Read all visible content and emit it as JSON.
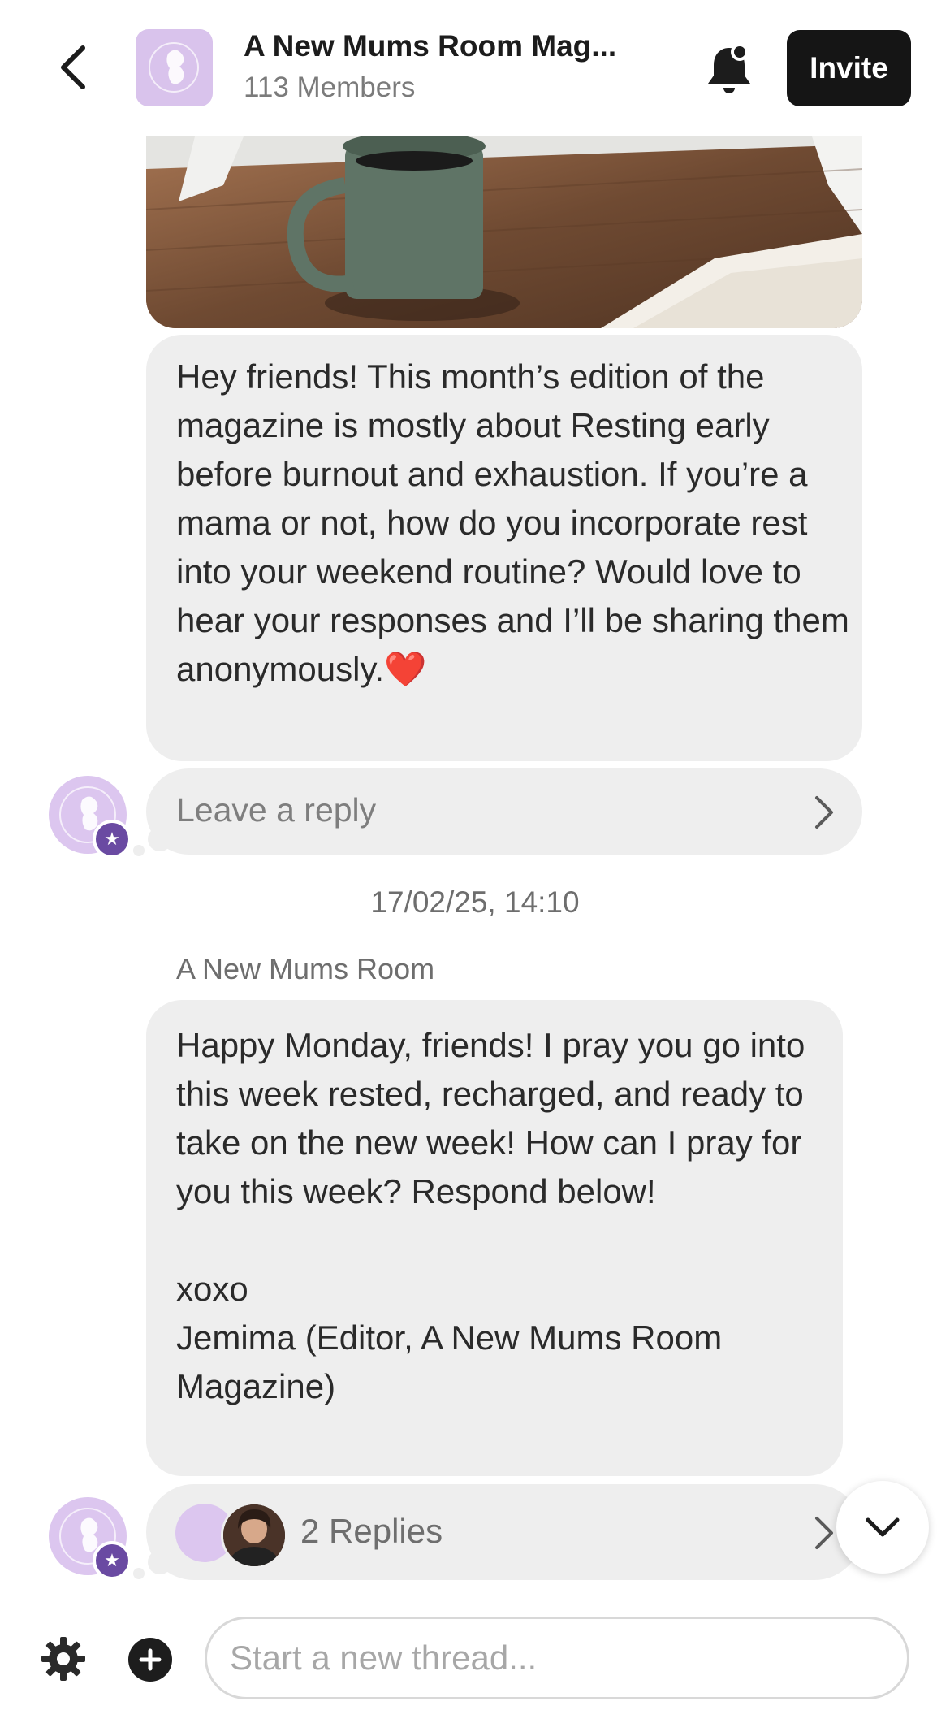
{
  "header": {
    "title": "A New Mums Room Mag...",
    "members": "113 Members",
    "invite_label": "Invite",
    "icons": {
      "back": "chevron-left-icon",
      "notifications": "bell-icon"
    }
  },
  "messages": [
    {
      "text": "Hey friends! This month’s edition of the magazine is mostly about Resting early before burnout and exhaustion. If you’re a mama or not, how do you incorporate rest into your weekend routine? Would love to hear your responses and I’ll be sharing them anonymously.",
      "emoji": "❤️",
      "reply_label": "Leave a reply"
    },
    {
      "timestamp": "17/02/25, 14:10",
      "sender": "A New Mums Room",
      "text": "Happy Monday, friends! I pray you go into this week rested, recharged, and ready to take on the new week! How can I pray for you this week? Respond below!\n\nxoxo\nJemima (Editor, A New Mums Room Magazine)",
      "replies_label": "2 Replies"
    }
  ],
  "composer": {
    "placeholder": "Start a new thread...",
    "icons": {
      "settings": "gear-icon",
      "add": "plus-circle-icon"
    }
  },
  "colors": {
    "accent": "#6a4aa2",
    "bubble": "#eeeeee",
    "avatar_bg": "#dcc6ef",
    "button": "#151515"
  }
}
